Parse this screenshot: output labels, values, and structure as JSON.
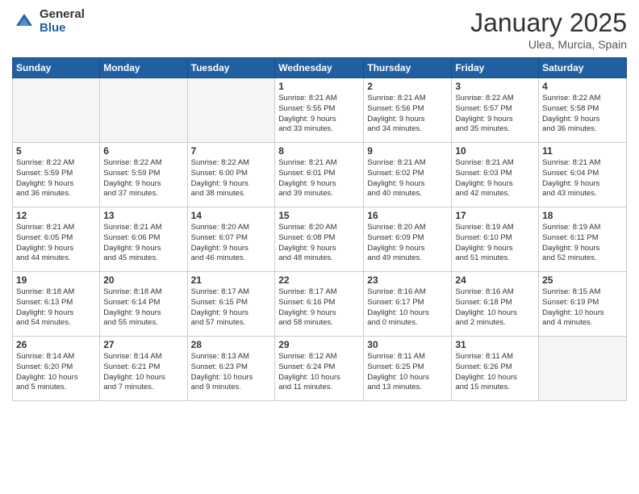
{
  "header": {
    "logo_general": "General",
    "logo_blue": "Blue",
    "month_title": "January 2025",
    "location": "Ulea, Murcia, Spain"
  },
  "days_of_week": [
    "Sunday",
    "Monday",
    "Tuesday",
    "Wednesday",
    "Thursday",
    "Friday",
    "Saturday"
  ],
  "weeks": [
    [
      {
        "day": "",
        "info": ""
      },
      {
        "day": "",
        "info": ""
      },
      {
        "day": "",
        "info": ""
      },
      {
        "day": "1",
        "info": "Sunrise: 8:21 AM\nSunset: 5:55 PM\nDaylight: 9 hours\nand 33 minutes."
      },
      {
        "day": "2",
        "info": "Sunrise: 8:21 AM\nSunset: 5:56 PM\nDaylight: 9 hours\nand 34 minutes."
      },
      {
        "day": "3",
        "info": "Sunrise: 8:22 AM\nSunset: 5:57 PM\nDaylight: 9 hours\nand 35 minutes."
      },
      {
        "day": "4",
        "info": "Sunrise: 8:22 AM\nSunset: 5:58 PM\nDaylight: 9 hours\nand 36 minutes."
      }
    ],
    [
      {
        "day": "5",
        "info": "Sunrise: 8:22 AM\nSunset: 5:59 PM\nDaylight: 9 hours\nand 36 minutes."
      },
      {
        "day": "6",
        "info": "Sunrise: 8:22 AM\nSunset: 5:59 PM\nDaylight: 9 hours\nand 37 minutes."
      },
      {
        "day": "7",
        "info": "Sunrise: 8:22 AM\nSunset: 6:00 PM\nDaylight: 9 hours\nand 38 minutes."
      },
      {
        "day": "8",
        "info": "Sunrise: 8:21 AM\nSunset: 6:01 PM\nDaylight: 9 hours\nand 39 minutes."
      },
      {
        "day": "9",
        "info": "Sunrise: 8:21 AM\nSunset: 6:02 PM\nDaylight: 9 hours\nand 40 minutes."
      },
      {
        "day": "10",
        "info": "Sunrise: 8:21 AM\nSunset: 6:03 PM\nDaylight: 9 hours\nand 42 minutes."
      },
      {
        "day": "11",
        "info": "Sunrise: 8:21 AM\nSunset: 6:04 PM\nDaylight: 9 hours\nand 43 minutes."
      }
    ],
    [
      {
        "day": "12",
        "info": "Sunrise: 8:21 AM\nSunset: 6:05 PM\nDaylight: 9 hours\nand 44 minutes."
      },
      {
        "day": "13",
        "info": "Sunrise: 8:21 AM\nSunset: 6:06 PM\nDaylight: 9 hours\nand 45 minutes."
      },
      {
        "day": "14",
        "info": "Sunrise: 8:20 AM\nSunset: 6:07 PM\nDaylight: 9 hours\nand 46 minutes."
      },
      {
        "day": "15",
        "info": "Sunrise: 8:20 AM\nSunset: 6:08 PM\nDaylight: 9 hours\nand 48 minutes."
      },
      {
        "day": "16",
        "info": "Sunrise: 8:20 AM\nSunset: 6:09 PM\nDaylight: 9 hours\nand 49 minutes."
      },
      {
        "day": "17",
        "info": "Sunrise: 8:19 AM\nSunset: 6:10 PM\nDaylight: 9 hours\nand 51 minutes."
      },
      {
        "day": "18",
        "info": "Sunrise: 8:19 AM\nSunset: 6:11 PM\nDaylight: 9 hours\nand 52 minutes."
      }
    ],
    [
      {
        "day": "19",
        "info": "Sunrise: 8:18 AM\nSunset: 6:13 PM\nDaylight: 9 hours\nand 54 minutes."
      },
      {
        "day": "20",
        "info": "Sunrise: 8:18 AM\nSunset: 6:14 PM\nDaylight: 9 hours\nand 55 minutes."
      },
      {
        "day": "21",
        "info": "Sunrise: 8:17 AM\nSunset: 6:15 PM\nDaylight: 9 hours\nand 57 minutes."
      },
      {
        "day": "22",
        "info": "Sunrise: 8:17 AM\nSunset: 6:16 PM\nDaylight: 9 hours\nand 58 minutes."
      },
      {
        "day": "23",
        "info": "Sunrise: 8:16 AM\nSunset: 6:17 PM\nDaylight: 10 hours\nand 0 minutes."
      },
      {
        "day": "24",
        "info": "Sunrise: 8:16 AM\nSunset: 6:18 PM\nDaylight: 10 hours\nand 2 minutes."
      },
      {
        "day": "25",
        "info": "Sunrise: 8:15 AM\nSunset: 6:19 PM\nDaylight: 10 hours\nand 4 minutes."
      }
    ],
    [
      {
        "day": "26",
        "info": "Sunrise: 8:14 AM\nSunset: 6:20 PM\nDaylight: 10 hours\nand 5 minutes."
      },
      {
        "day": "27",
        "info": "Sunrise: 8:14 AM\nSunset: 6:21 PM\nDaylight: 10 hours\nand 7 minutes."
      },
      {
        "day": "28",
        "info": "Sunrise: 8:13 AM\nSunset: 6:23 PM\nDaylight: 10 hours\nand 9 minutes."
      },
      {
        "day": "29",
        "info": "Sunrise: 8:12 AM\nSunset: 6:24 PM\nDaylight: 10 hours\nand 11 minutes."
      },
      {
        "day": "30",
        "info": "Sunrise: 8:11 AM\nSunset: 6:25 PM\nDaylight: 10 hours\nand 13 minutes."
      },
      {
        "day": "31",
        "info": "Sunrise: 8:11 AM\nSunset: 6:26 PM\nDaylight: 10 hours\nand 15 minutes."
      },
      {
        "day": "",
        "info": ""
      }
    ]
  ]
}
